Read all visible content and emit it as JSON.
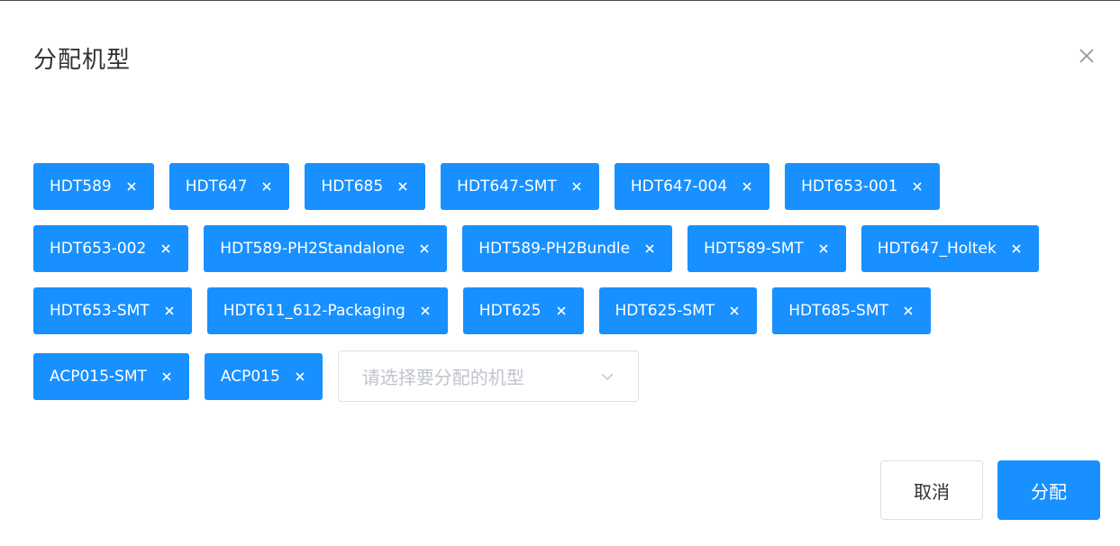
{
  "dialog": {
    "title": "分配机型",
    "close_icon": "close-icon"
  },
  "tags": {
    "row1": [
      "HDT589",
      "HDT647",
      "HDT685",
      "HDT647-SMT",
      "HDT647-004",
      "HDT653-001"
    ],
    "row2": [
      "HDT653-002",
      "HDT589-PH2Standalone",
      "HDT589-PH2Bundle",
      "HDT589-SMT",
      "HDT647_Holtek"
    ],
    "row3": [
      "HDT653-SMT",
      "HDT611_612-Packaging",
      "HDT625",
      "HDT625-SMT",
      "HDT685-SMT"
    ],
    "row4": [
      "ACP015-SMT",
      "ACP015"
    ]
  },
  "select": {
    "placeholder": "请选择要分配的机型",
    "icon": "chevron-down-icon"
  },
  "footer": {
    "cancel_label": "取消",
    "confirm_label": "分配"
  },
  "colors": {
    "accent": "#1890ff",
    "text": "#303133",
    "placeholder": "#c0c4cc",
    "border": "#dcdfe6"
  }
}
